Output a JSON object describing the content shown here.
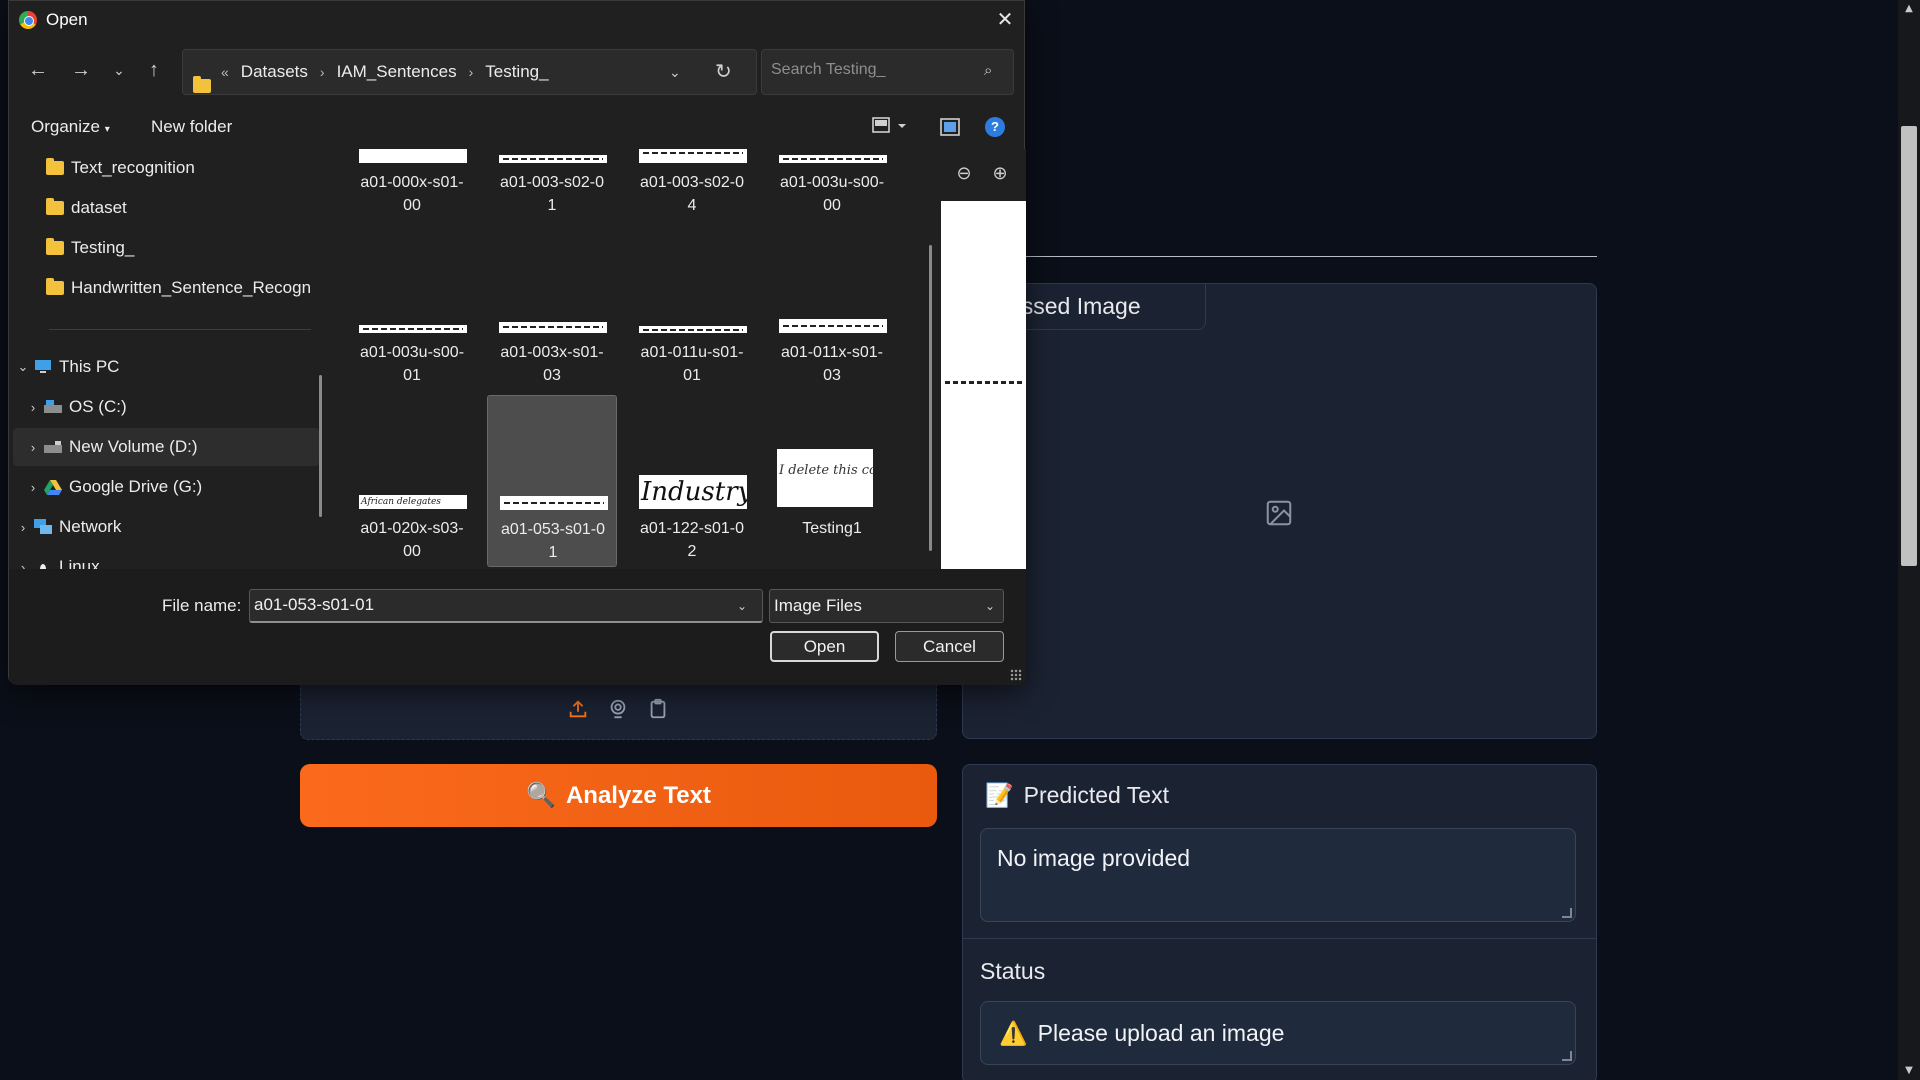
{
  "app": {
    "processed_tab": "rocessed Image",
    "analyze_button": "Analyze Text",
    "analyze_emoji": "🔍",
    "predicted_title": "Predicted Text",
    "predicted_emoji": "📝",
    "predicted_value": "No image provided",
    "status_label": "Status",
    "status_emoji": "⚠️",
    "status_value": "Please upload an image",
    "colors": {
      "accent": "#f97316",
      "background": "#0b0f19",
      "panel": "#1b2232"
    }
  },
  "dialog": {
    "title": "Open",
    "close_glyph": "✕",
    "breadcrumbs": [
      "Datasets",
      "IAM_Sentences",
      "Testing_"
    ],
    "breadcrumb_prefix": "«",
    "search_placeholder": "Search Testing_",
    "toolbar": {
      "organize": "Organize",
      "new_folder": "New folder"
    },
    "nav_items": [
      {
        "label": "Text_recognition",
        "type": "folder"
      },
      {
        "label": "dataset",
        "type": "folder"
      },
      {
        "label": "Testing_",
        "type": "folder"
      },
      {
        "label": "Handwritten_Sentence_Recogn",
        "type": "folder"
      },
      {
        "label": "This PC",
        "type": "pc",
        "expanded": true
      },
      {
        "label": "OS (C:)",
        "type": "drive"
      },
      {
        "label": "New Volume (D:)",
        "type": "drive",
        "selected": true
      },
      {
        "label": "Google Drive (G:)",
        "type": "gdrive"
      },
      {
        "label": "Network",
        "type": "network"
      },
      {
        "label": "Linux",
        "type": "linux"
      }
    ],
    "files": [
      {
        "line1": "a01-000x-s01-",
        "line2": "00"
      },
      {
        "line1": "a01-003-s02-0",
        "line2": "1"
      },
      {
        "line1": "a01-003-s02-0",
        "line2": "4"
      },
      {
        "line1": "a01-003u-s00-",
        "line2": "00"
      },
      {
        "line1": "a01-003u-s00-",
        "line2": "01"
      },
      {
        "line1": "a01-003x-s01-",
        "line2": "03"
      },
      {
        "line1": "a01-011u-s01-",
        "line2": "01"
      },
      {
        "line1": "a01-011x-s01-",
        "line2": "03"
      },
      {
        "line1": "a01-020x-s03-",
        "line2": "00"
      },
      {
        "line1": "a01-053-s01-0",
        "line2": "1",
        "selected": true
      },
      {
        "line1": "a01-122-s01-0",
        "line2": "2"
      },
      {
        "line1": "Testing1",
        "line2": ""
      }
    ],
    "thumb_texts": [
      "African delegates",
      "Industry.",
      "I delete this comb"
    ],
    "file_name_label": "File name:",
    "file_name_value": "a01-053-s01-01",
    "file_type": "Image Files",
    "open_button": "Open",
    "cancel_button": "Cancel"
  }
}
